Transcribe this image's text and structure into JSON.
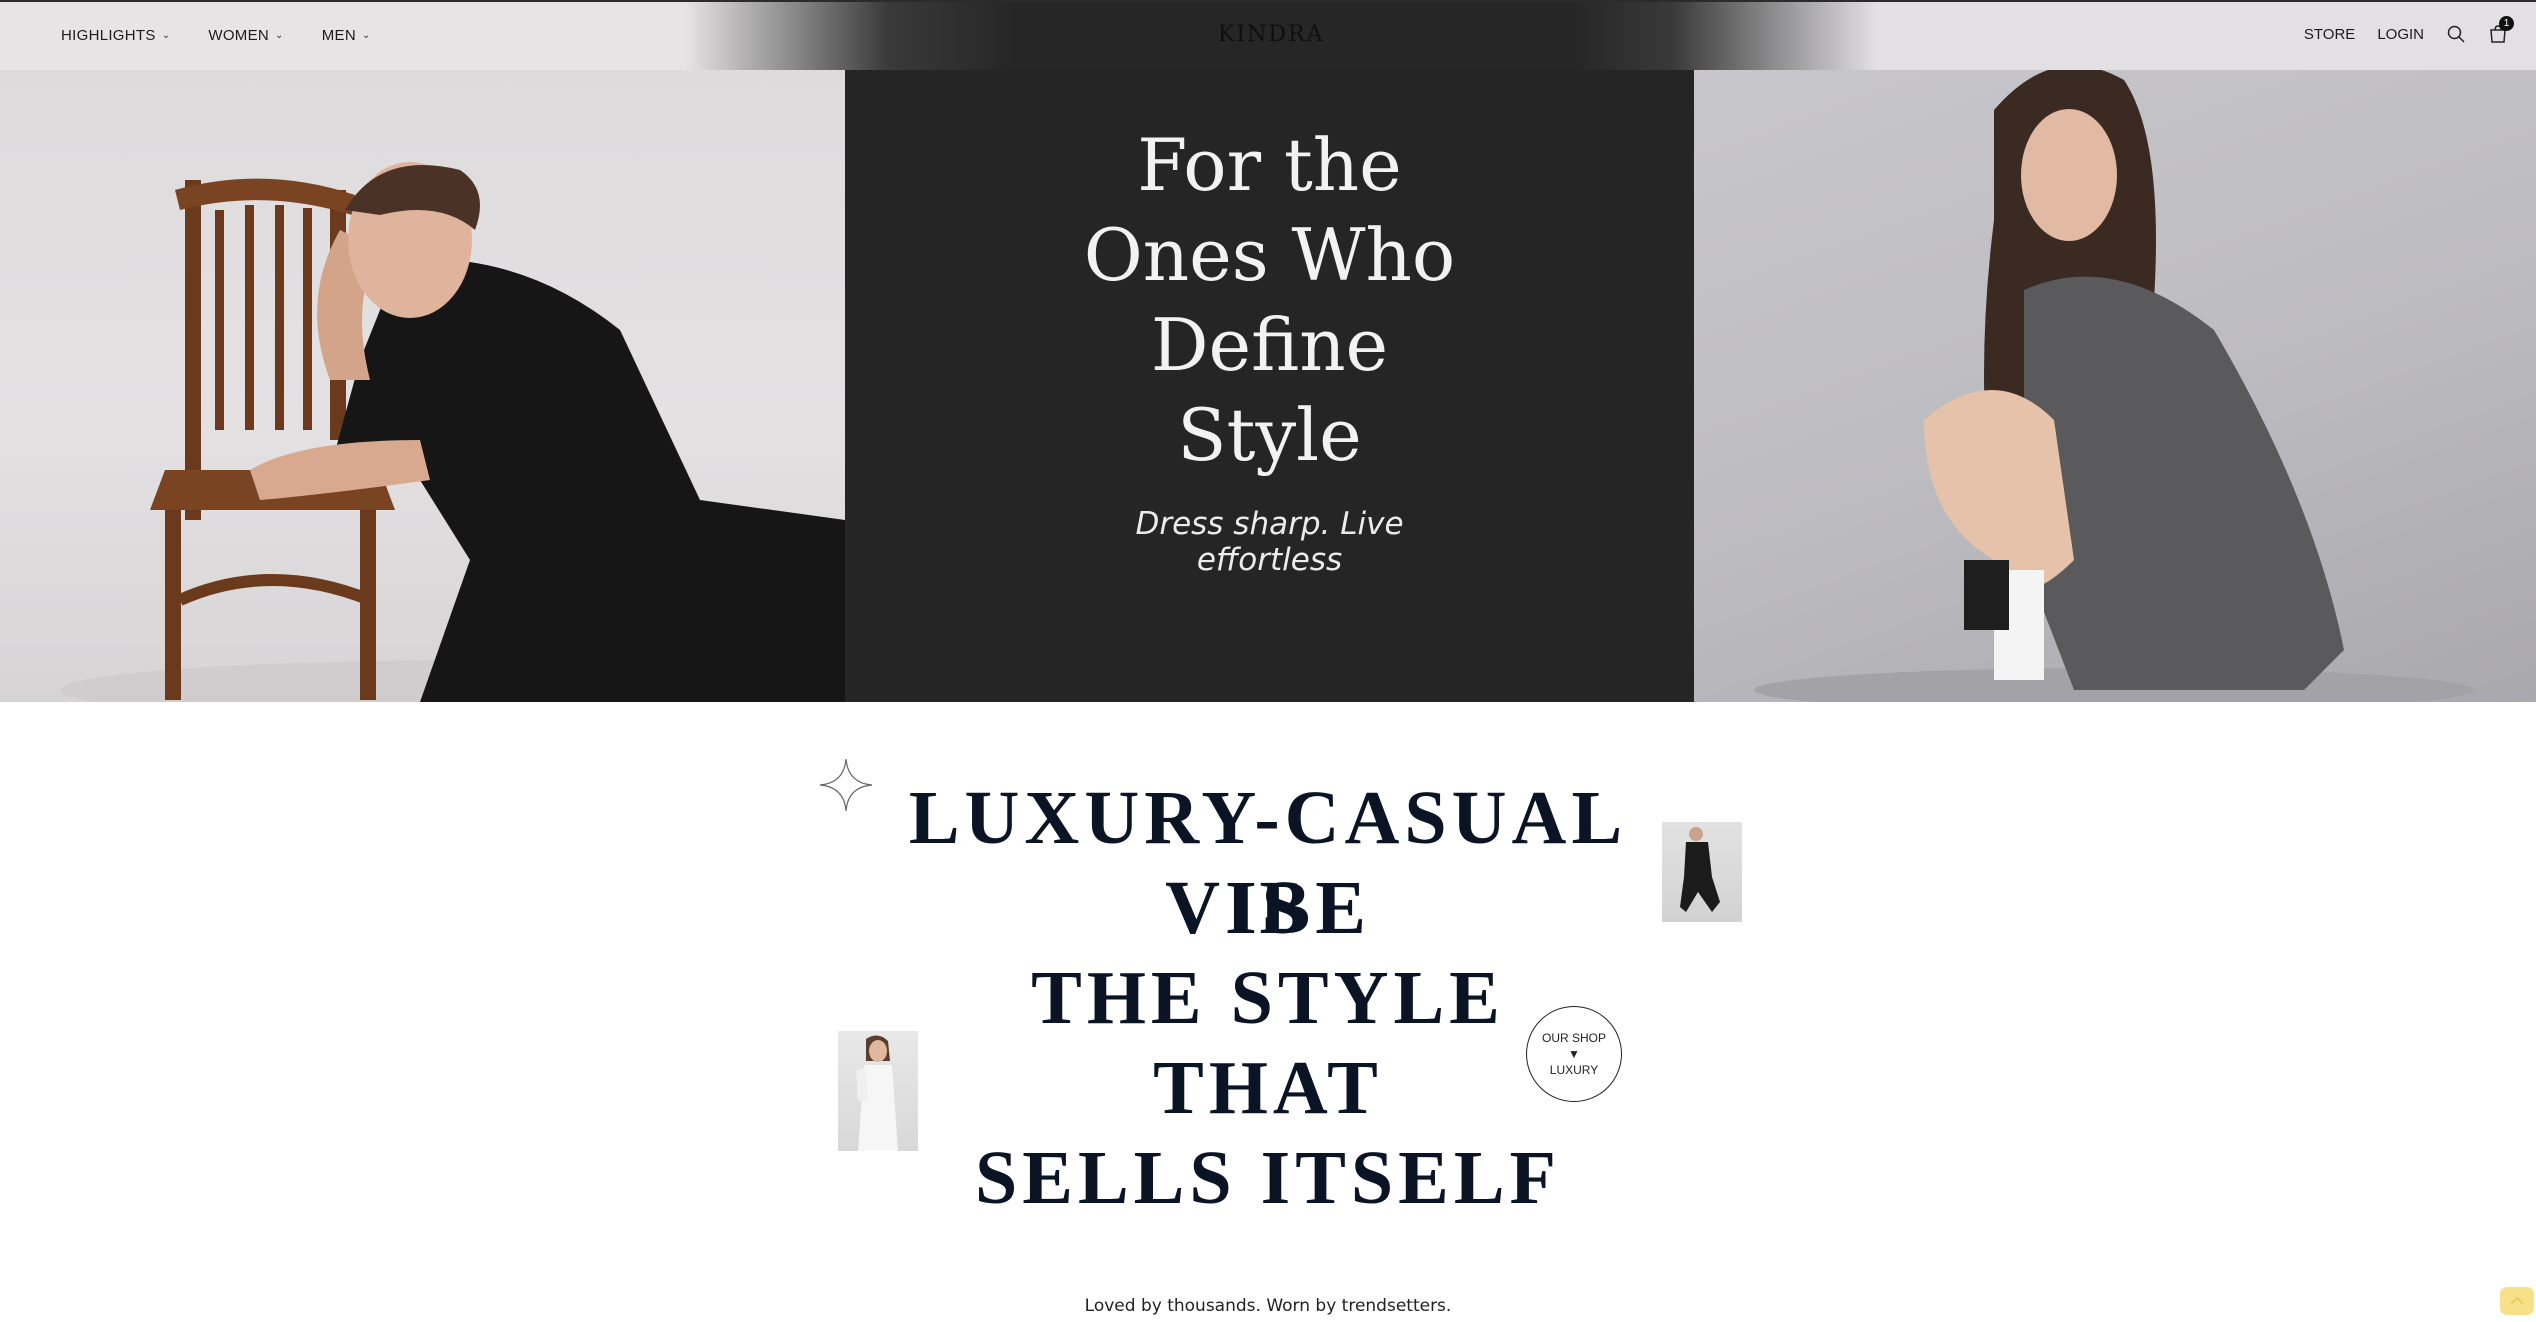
{
  "header": {
    "nav_left": [
      {
        "label": "HIGHLIGHTS"
      },
      {
        "label": "WOMEN"
      },
      {
        "label": "MEN"
      }
    ],
    "logo": "KINDRA",
    "store_label": "STORE",
    "login_label": "LOGIN",
    "search_icon": "search-icon",
    "cart_icon": "cart-icon",
    "cart_count": "1"
  },
  "hero": {
    "title_lines": [
      "For the",
      "Ones Who",
      "Define",
      "Style"
    ],
    "subtitle_lines": [
      "Dress sharp. Live",
      "effortless"
    ],
    "panel_color": "#252525"
  },
  "luxury": {
    "lines": [
      "LUXURY-CASUAL VIBE",
      "IS",
      "THE STYLE",
      "THAT",
      "SELLS ITSELF"
    ],
    "badge": {
      "top": "OUR SHOP",
      "arrow": "▼",
      "bottom": "LUXURY"
    },
    "tagline": "Loved by thousands. Worn by trendsetters."
  }
}
